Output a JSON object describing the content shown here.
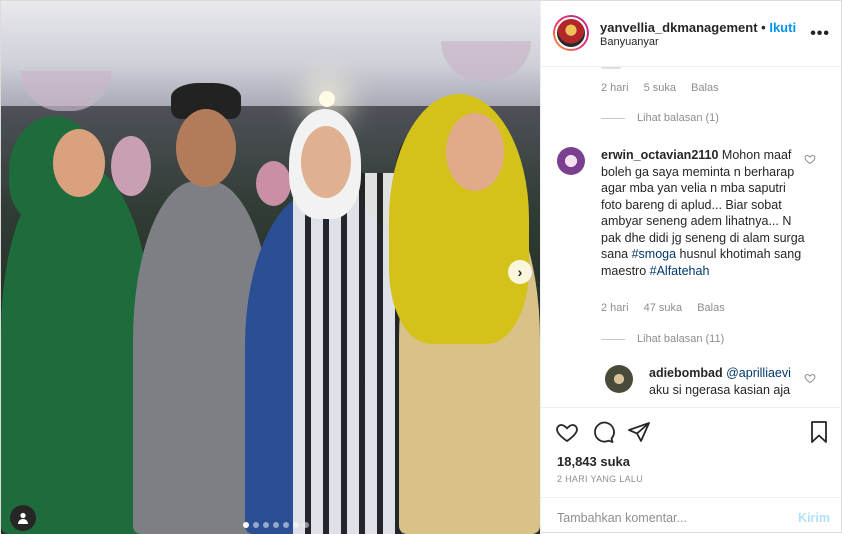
{
  "header": {
    "username": "yanvellia_dkmanagement",
    "separator": "•",
    "follow_label": "Ikuti",
    "location": "Banyuanyar",
    "more_label": "•••"
  },
  "comments": {
    "first": {
      "meta_time": "2 hari",
      "meta_likes": "5 suka",
      "meta_reply": "Balas",
      "view_replies": "Lihat balasan (1)"
    },
    "second": {
      "username": "erwin_octavian2110",
      "text_1": "Mohon maaf boleh ga saya meminta n berharap agar mba yan velia n mba saputri foto bareng di aplud... Biar sobat ambyar seneng adem lihatnya... N pak dhe didi jg seneng di alam surga sana ",
      "hashtag_1": "#smoga",
      "text_2": " husnul khotimah sang maestro ",
      "hashtag_2": "#Alfatehah",
      "meta_time": "2 hari",
      "meta_likes": "47 suka",
      "meta_reply": "Balas",
      "view_replies": "Lihat balasan (11)"
    },
    "third": {
      "username": "adiebombad",
      "mention": "@aprilliaevi",
      "text": "aku si ngerasa kasian aja"
    }
  },
  "actions": {
    "likes": "18,843 suka",
    "time": "2 HARI YANG LALU"
  },
  "add_comment": {
    "placeholder": "Tambahkan komentar...",
    "post_label": "Kirim"
  },
  "photo": {
    "next_label": "›",
    "carousel_count": 7,
    "carousel_active": 1
  },
  "colors": {
    "follow_blue": "#0095f6",
    "link_blue": "#00376b",
    "meta_gray": "#8e8e8e",
    "post_disabled": "#b2dffc"
  }
}
